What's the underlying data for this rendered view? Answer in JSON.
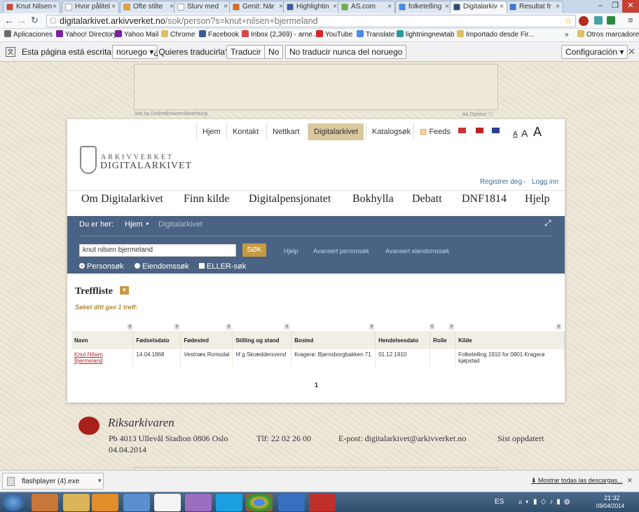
{
  "browser": {
    "tabs": [
      {
        "title": "Knut Nilsen",
        "color": "#d14836"
      },
      {
        "title": "Hvor pålitel",
        "color": "#ffffff"
      },
      {
        "title": "Ofte stilte",
        "color": "#e8a035"
      },
      {
        "title": "Slurv med",
        "color": "#ffffff"
      },
      {
        "title": "Genit: När",
        "color": "#e06b20"
      },
      {
        "title": "Highlightin",
        "color": "#3b5ba5"
      },
      {
        "title": "AS.com",
        "color": "#6ab04c"
      },
      {
        "title": "folketelling",
        "color": "#4a8ae8"
      },
      {
        "title": "Digitalarkiv",
        "color": "#2d4b7e"
      },
      {
        "title": "Resultat fr",
        "color": "#3b7bd1"
      }
    ],
    "active_tab_index": 8,
    "window_controls": {
      "minimize": "–",
      "maximize": "❐",
      "close": "✕"
    },
    "url_host": "digitalarkivet.arkivverket.no",
    "url_path": "/sok/person?s=knut+nilsen+bjermeland",
    "bookmarks": [
      "Aplicaciones",
      "Yahoo! Directory",
      "Yahoo Mail",
      "Chrome",
      "Facebook",
      "Inbox (2,369) - arne....",
      "YouTube",
      "Translate",
      "lightningnewtab",
      "Importado desde Fir...",
      "»",
      "Otros marcadores"
    ],
    "translate_bar": {
      "text": "Esta página está escrita en",
      "language": "noruego",
      "question": "¿Quieres traducirla?",
      "translate_btn": "Traducir",
      "no_btn": "No",
      "never_btn": "No traducir nunca del noruego",
      "settings_btn": "Configuración"
    }
  },
  "site": {
    "ad_left": "Ads by OnlineBrowserAdvertising",
    "ad_right": "Ad Options",
    "logo_line1": "ARKIVVERKET",
    "logo_line2": "DIGITALARKIVET",
    "top_nav": [
      "Hjem",
      "Kontakt",
      "Nettkart",
      "Digitalarkivet",
      "Katalogsøk",
      "Feeds"
    ],
    "font_sizes": [
      "A",
      "A",
      "A"
    ],
    "register": "Registrer deg",
    "sep": "-",
    "login": "Logg inn",
    "main_nav": [
      "Om Digitalarkivet",
      "Finn kilde",
      "Digitalpensjonatet",
      "Bokhylla",
      "Debatt",
      "DNF1814",
      "Hjelp"
    ],
    "breadcrumb_label": "Du er her:",
    "breadcrumb_home": "Hjem",
    "breadcrumb_current": "Digitalarkivet",
    "search_value": "knut nilsen bjermeland",
    "search_button": "SØK",
    "search_links": [
      "Hjelp",
      "Avansert personsøk",
      "Avansert eiendomssøk"
    ],
    "search_options": [
      "Personsøk",
      "Eiendomssøk",
      "ELLER-søk"
    ],
    "results_title": "Treffliste",
    "results_count": "Søket ditt gav 1 treff:",
    "columns": [
      "Navn",
      "Fødselsdato",
      "Fødested",
      "Stilling og stand",
      "Bosted",
      "Hendelsesdato",
      "Rolle",
      "Kilde"
    ],
    "rows": [
      {
        "navn": "Knut Nilsen Bjermeland",
        "fodselsdato": "14.04.1868",
        "fodested": "Vestnæs Romsdal",
        "stilling": "hf g Skræddersvend",
        "bosted": "Kragerø: Bjørnsborgbakken 71",
        "hendelsesdato": "01.12.1910",
        "rolle": "",
        "kilde": "Folketelling 1910 for 0801 Kragerø kjøpstad"
      }
    ],
    "page_number": "1",
    "footer": {
      "brand": "Riksarkivaren",
      "address": "Pb 4013 Ullevål Stadion 0806 Oslo",
      "phone": "Tlf: 22 02 26 00",
      "email": "E-post: digitalarkivet@arkivverket.no",
      "updated_label": "Sist oppdatert",
      "updated_date": "04.04.2014"
    }
  },
  "downloads": {
    "file": "flashplayer (4).exe",
    "show_all": "Mostrar todas las descargas...",
    "close": "×"
  },
  "taskbar": {
    "lang": "ES",
    "time": "21:32",
    "date": "09/04/2014"
  }
}
